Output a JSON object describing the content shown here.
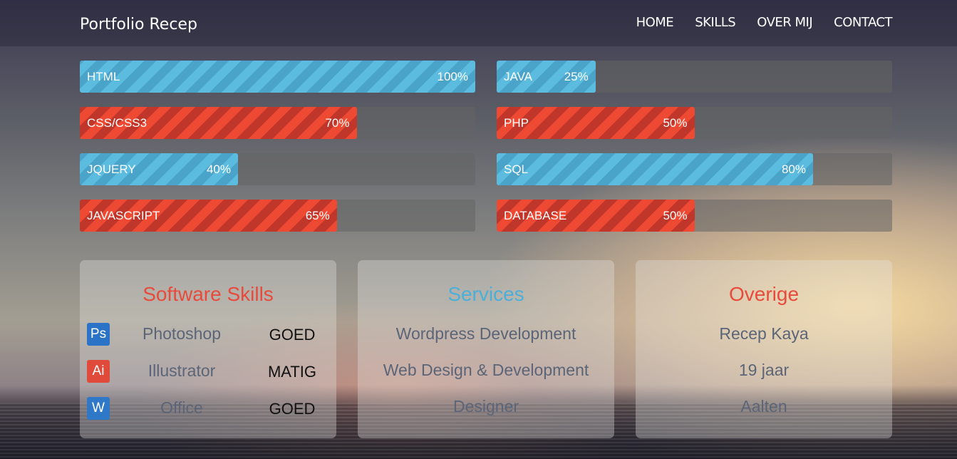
{
  "brand": "Portfolio Recep",
  "nav": [
    "HOME",
    "SKILLS",
    "OVER MIJ",
    "CONTACT"
  ],
  "skills_left": [
    {
      "label": "HTML",
      "percent_text": "100%",
      "value": 100,
      "color": "blue"
    },
    {
      "label": "CSS/CSS3",
      "percent_text": "70%",
      "value": 70,
      "color": "red"
    },
    {
      "label": "JQUERY",
      "percent_text": "40%",
      "value": 40,
      "color": "blue"
    },
    {
      "label": "JAVASCRIPT",
      "percent_text": "65%",
      "value": 65,
      "color": "red"
    }
  ],
  "skills_right": [
    {
      "label": "JAVA",
      "percent_text": "25%",
      "value": 25,
      "color": "blue"
    },
    {
      "label": "PHP",
      "percent_text": "50%",
      "value": 50,
      "color": "red"
    },
    {
      "label": "SQL",
      "percent_text": "80%",
      "value": 80,
      "color": "blue"
    },
    {
      "label": "DATABASE",
      "percent_text": "50%",
      "value": 50,
      "color": "red"
    }
  ],
  "software": {
    "title": "Software Skills",
    "title_color": "#e84a3b",
    "rows": [
      {
        "icon_text": "Ps",
        "icon": "photoshop-icon",
        "icon_color": "#2a73c7",
        "name": "Photoshop",
        "level": "GOED"
      },
      {
        "icon_text": "Ai",
        "icon": "illustrator-icon",
        "icon_color": "#e04a3a",
        "name": "Illustrator",
        "level": "MATIG"
      },
      {
        "icon_text": "W",
        "icon": "word-icon",
        "icon_color": "#2f78c8",
        "name": "Office",
        "level": "GOED"
      }
    ]
  },
  "services": {
    "title": "Services",
    "title_color": "#4ab0da",
    "items": [
      "Wordpress Development",
      "Web Design & Development",
      "Designer"
    ]
  },
  "overige": {
    "title": "Overige",
    "title_color": "#e84a3b",
    "items": [
      "Recep Kaya",
      "19 jaar",
      "Aalten"
    ]
  }
}
